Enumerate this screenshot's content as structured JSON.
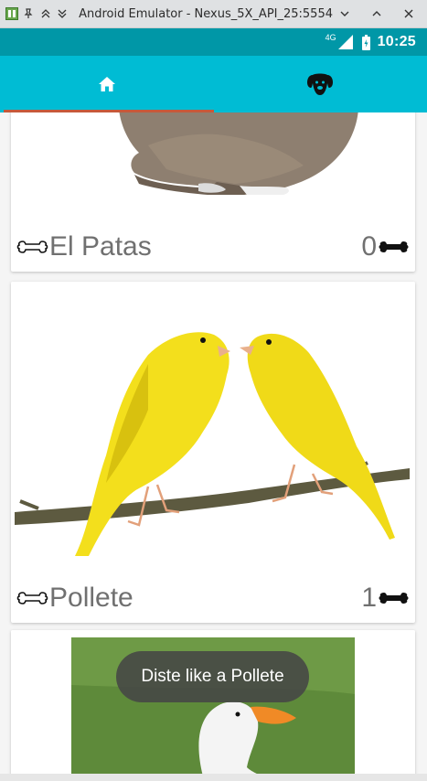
{
  "window": {
    "title": "Android Emulator - Nexus_5X_API_25:5554"
  },
  "statusbar": {
    "network": "4G",
    "time": "10:25"
  },
  "tabs": [
    {
      "icon": "home-icon"
    },
    {
      "icon": "dog-face-icon"
    }
  ],
  "pets": [
    {
      "name": "El Patas",
      "likes": "0",
      "image": "rabbit"
    },
    {
      "name": "Pollete",
      "likes": "1",
      "image": "canaries"
    },
    {
      "name": "",
      "likes": "",
      "image": "duck"
    }
  ],
  "toast": {
    "message": "Diste like a Pollete"
  },
  "colors": {
    "statusbar": "#0097a7",
    "toolbar": "#00bcd4",
    "tab_indicator": "#c5593b",
    "card": "#ffffff",
    "text": "#707070"
  }
}
